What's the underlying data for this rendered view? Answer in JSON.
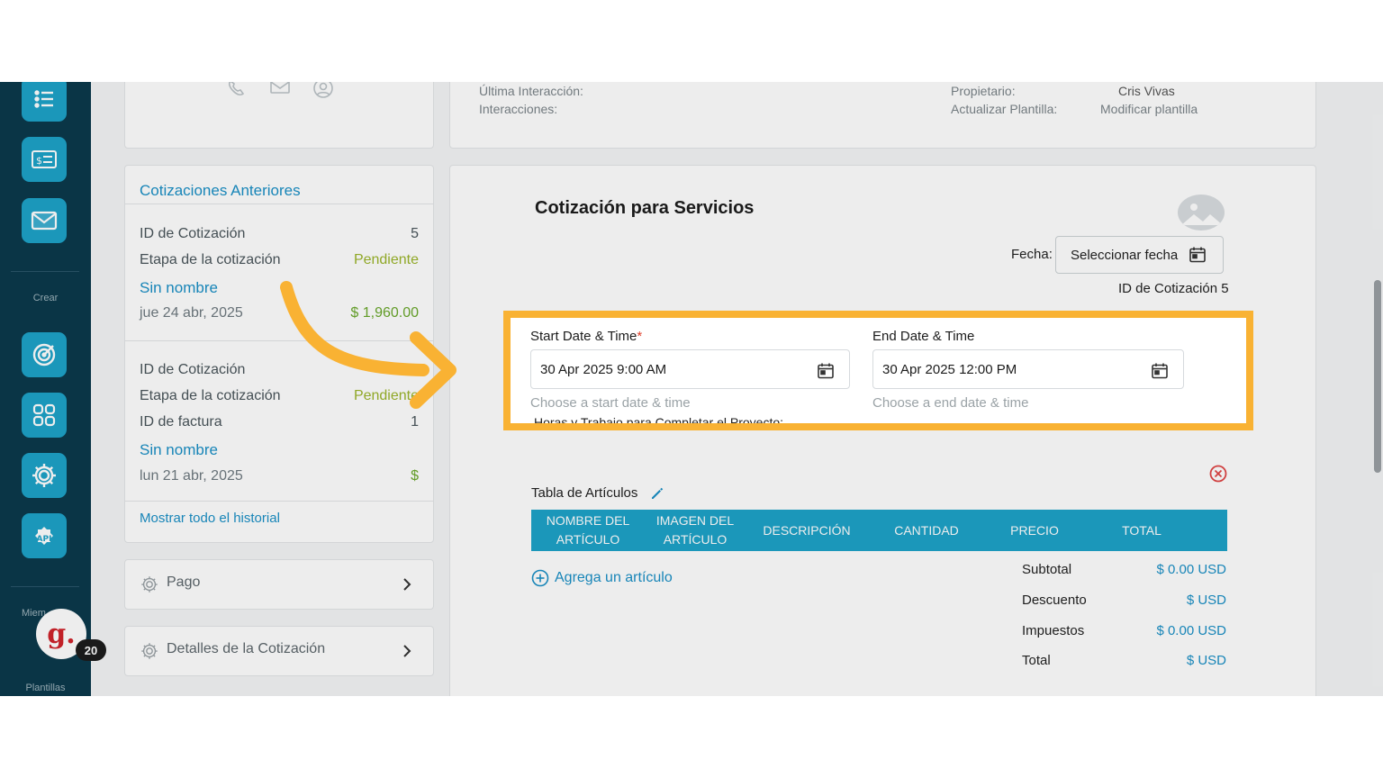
{
  "sidebar": {
    "crear_label": "Crear",
    "miembros_label": "Miem",
    "plantillas_label": "Plantillas",
    "avatar_letter": "g.",
    "badge_count": "20",
    "icons": [
      "list-icon",
      "invoice-icon",
      "mail-icon",
      "target-icon",
      "grid-icon",
      "gear-icon",
      "api-icon"
    ],
    "api_text": "API",
    "accent": "#1ea3c9"
  },
  "info": {
    "last_interaction_label": "Última Interacción:",
    "interactions_label": "Interacciones:",
    "owner_label": "Propietario:",
    "owner_value": "Cris Vivas",
    "update_template_label": "Actualizar Plantilla:",
    "update_template_link": "Modificar plantilla"
  },
  "previous_quotes": {
    "title": "Cotizaciones Anteriores",
    "quote1": {
      "id_label": "ID de Cotización",
      "id_value": "5",
      "stage_label": "Etapa de la cotización",
      "stage_value": "Pendiente",
      "name": "Sin nombre",
      "date": "jue 24 abr, 2025",
      "amount": "$ 1,960.00"
    },
    "quote2": {
      "id_label": "ID de Cotización",
      "stage_label": "Etapa de la cotización",
      "stage_value": "Pendiente",
      "invoice_label": "ID de factura",
      "invoice_value": "1",
      "name": "Sin nombre",
      "date": "lun 21 abr, 2025",
      "amount": "$"
    },
    "show_history": "Mostrar todo el historial"
  },
  "accordions": {
    "payment": "Pago",
    "details": "Detalles de la Cotización"
  },
  "quote": {
    "title": "Cotización para Servicios",
    "fecha_label": "Fecha:",
    "fecha_button": "Seleccionar fecha",
    "quote_id": "ID de Cotización 5"
  },
  "schedule": {
    "start_label": "Start Date & Time",
    "required_mark": "*",
    "start_value": "30 Apr 2025 9:00 AM",
    "start_help": "Choose a start date & time",
    "end_label": "End Date & Time",
    "end_value": "30 Apr 2025 12:00 PM",
    "end_help": "Choose a end date & time",
    "cut_text": "Horas y Trabajo para Completar el Proyecto:",
    "highlight_color": "#f9b233"
  },
  "items": {
    "label": "Tabla de Artículos",
    "columns": [
      "NOMBRE DEL ARTÍCULO",
      "IMAGEN DEL ARTÍCULO",
      "DESCRIPCIÓN",
      "CANTIDAD",
      "PRECIO",
      "TOTAL"
    ],
    "add_item": "Agrega un artículo"
  },
  "totals": {
    "subtotal_label": "Subtotal",
    "subtotal_value": "$ 0.00 USD",
    "discount_label": "Descuento",
    "discount_value": "$ USD",
    "tax_label": "Impuestos",
    "tax_value": "$ 0.00 USD",
    "total_label": "Total",
    "total_value": "$ USD"
  }
}
